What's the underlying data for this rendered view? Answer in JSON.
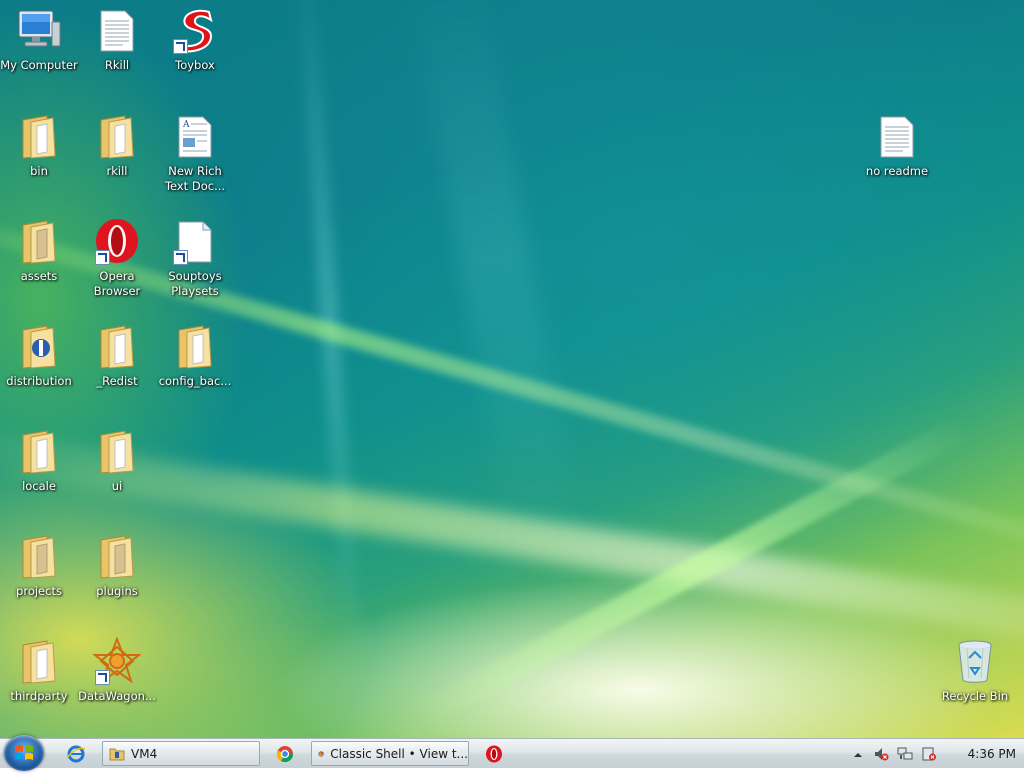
{
  "desktop": {
    "icons": {
      "my_computer": "My Computer",
      "rkill_file": "Rkill",
      "toybox": "Toybox",
      "bin": "bin",
      "rkill_folder": "rkill",
      "new_rich_text": "New Rich Text Doc...",
      "assets": "assets",
      "opera": "Opera Browser",
      "souptoys": "Souptoys Playsets",
      "distribution": "distribution",
      "redist": "_Redist",
      "config_backup": "config_bac...",
      "locale": "locale",
      "ui": "ui",
      "projects": "projects",
      "plugins": "plugins",
      "thirdparty": "thirdparty",
      "datawagon": "DataWagon...",
      "no_readme": "no readme",
      "recycle_bin": "Recycle Bin"
    }
  },
  "taskbar": {
    "window_vm4": "VM4",
    "window_firefox": "Classic Shell • View t...",
    "clock": "4:36 PM"
  },
  "colors": {
    "taskbar_top": "#f2f5f6",
    "taskbar_bottom": "#c6d0d5",
    "label_text": "#ffffff",
    "folder": "#f0d070",
    "opera_red": "#e0141e",
    "toybox_red": "#e01414"
  },
  "icon_names": {
    "computer": "computer-icon",
    "text_file": "text-file-icon",
    "folder": "folder-icon",
    "opera": "opera-icon",
    "recycle_bin": "recycle-bin-icon",
    "firefox": "firefox-icon",
    "chrome": "chrome-icon",
    "ie": "internet-explorer-icon"
  }
}
